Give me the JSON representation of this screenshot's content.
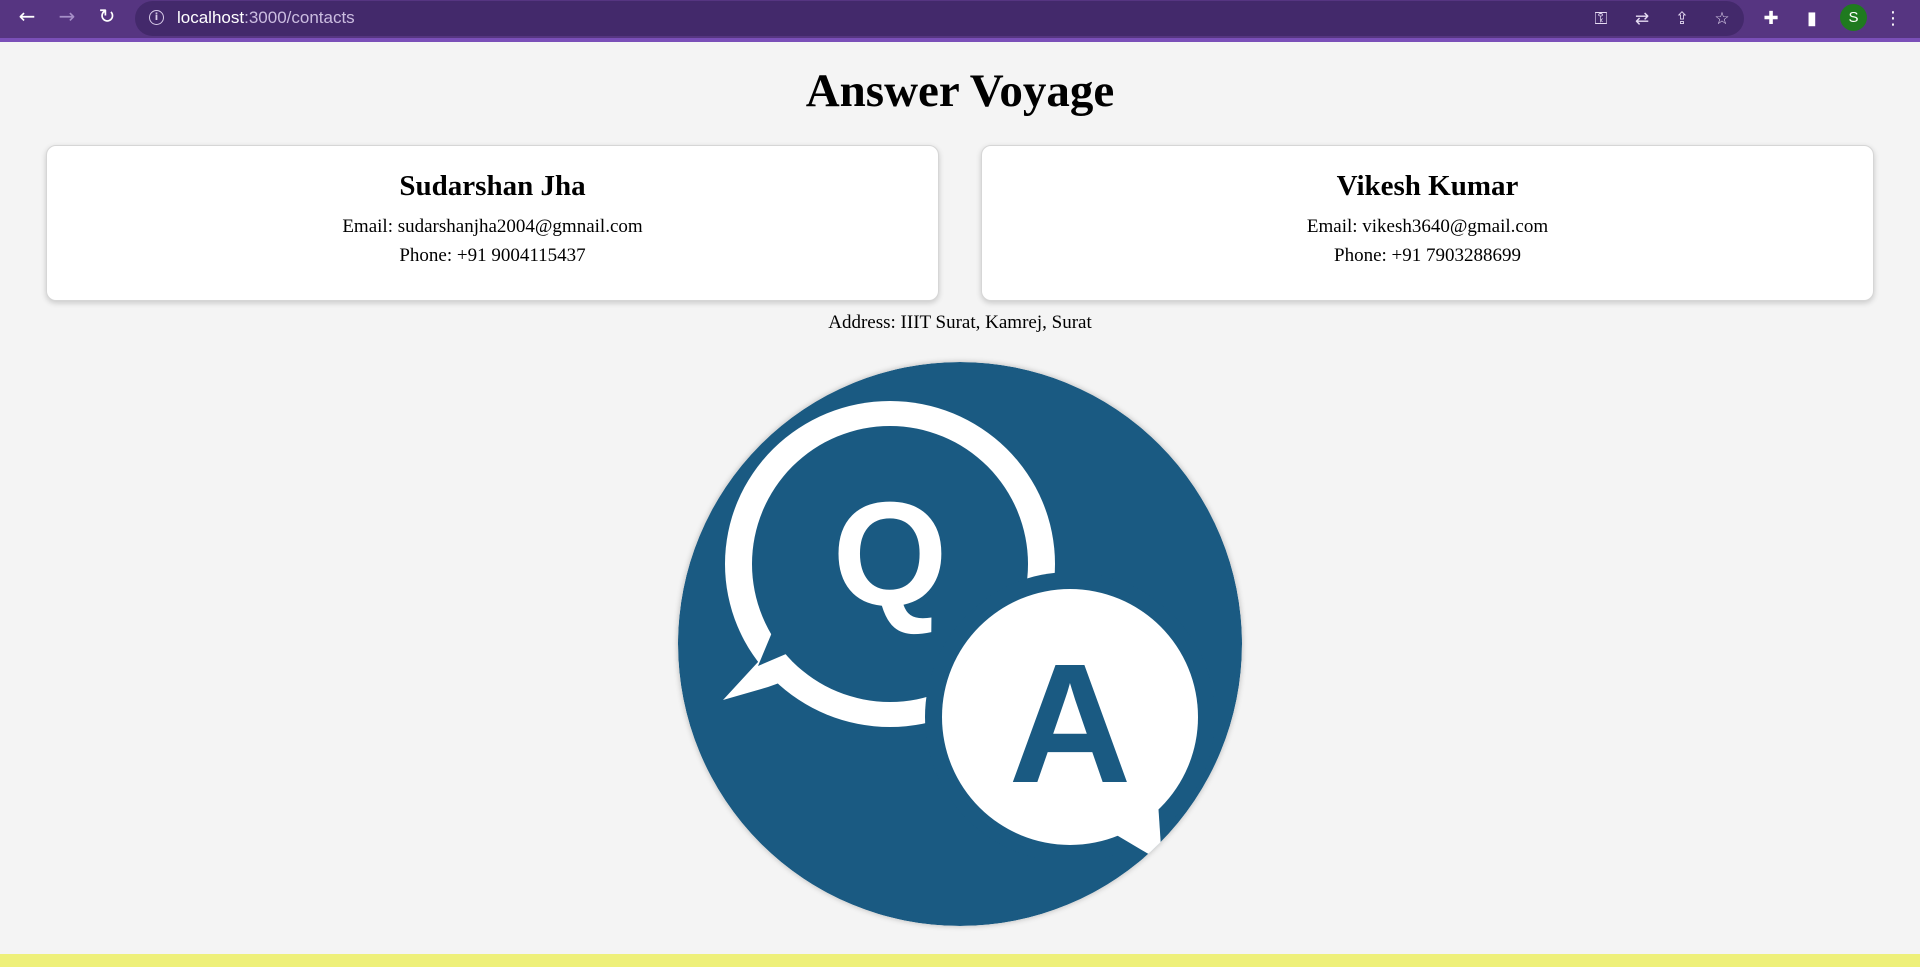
{
  "browser": {
    "url_host": "localhost",
    "url_path": ":3000/contacts",
    "profile_initial": "S",
    "theme_color": "#563581"
  },
  "site": {
    "title": "Answer Voyage"
  },
  "contacts": [
    {
      "name": "Sudarshan Jha",
      "email": "Email: sudarshanjha2004@gmnail.com",
      "phone": "Phone: +91 9004115437"
    },
    {
      "name": "Vikesh Kumar",
      "email": "Email: vikesh3640@gmail.com",
      "phone": "Phone: +91 7903288699"
    }
  ],
  "address": "Address: IIIT Surat, Kamrej, Surat",
  "logo": {
    "q_letter": "Q",
    "a_letter": "A",
    "bg_color": "#1a5a82",
    "fg_color": "#ffffff"
  },
  "footer_strip_color": "#eef07a"
}
